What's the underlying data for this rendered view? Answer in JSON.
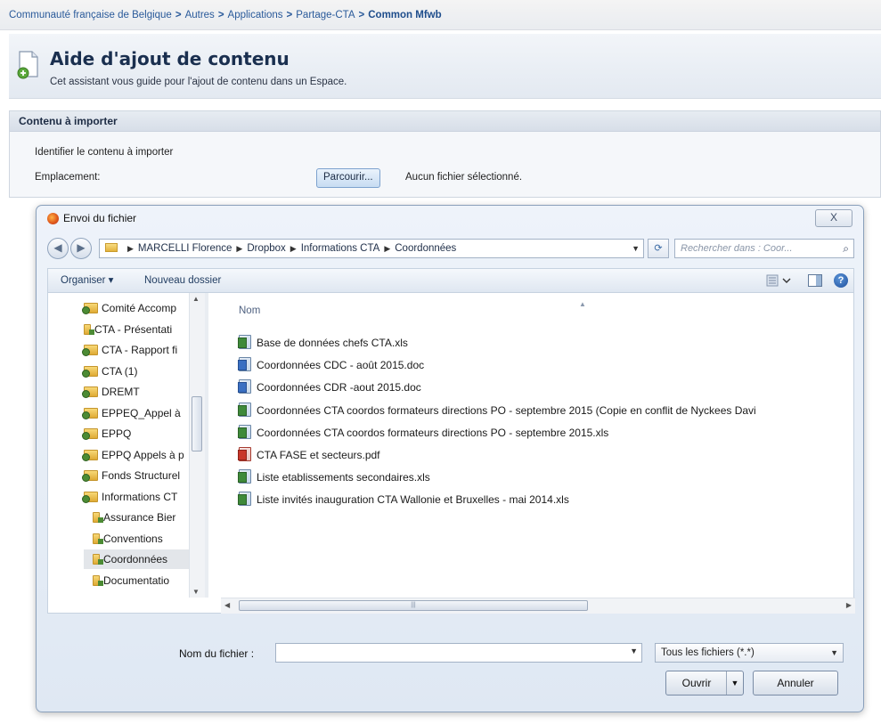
{
  "breadcrumb": {
    "items": [
      "Communauté française de Belgique",
      "Autres",
      "Applications",
      "Partage-CTA"
    ],
    "current": "Common Mfwb",
    "separator": ">"
  },
  "banner": {
    "title": "Aide d'ajout de contenu",
    "subtitle": "Cet assistant vous guide pour l'ajout de contenu dans un Espace."
  },
  "import": {
    "section_title": "Contenu à importer",
    "identify_label": "Identifier le contenu à importer",
    "location_label": "Emplacement:",
    "browse_label": "Parcourir...",
    "no_file_text": "Aucun fichier sélectionné."
  },
  "dialog": {
    "title": "Envoi du fichier",
    "close_label": "X",
    "address": {
      "segments": [
        "MARCELLI Florence",
        "Dropbox",
        "Informations CTA",
        "Coordonnées"
      ]
    },
    "search_placeholder": "Rechercher dans : Coor...",
    "toolbar": {
      "organize": "Organiser ▾",
      "new_folder": "Nouveau dossier"
    },
    "tree": [
      {
        "label": "Comité Accomp",
        "type": "shared",
        "indent": 0
      },
      {
        "label": "CTA - Présentati",
        "type": "sub",
        "indent": 0
      },
      {
        "label": "CTA - Rapport fi",
        "type": "shared",
        "indent": 0
      },
      {
        "label": "CTA (1)",
        "type": "shared",
        "indent": 0
      },
      {
        "label": "DREMT",
        "type": "shared",
        "indent": 0
      },
      {
        "label": "EPPEQ_Appel à",
        "type": "shared",
        "indent": 0
      },
      {
        "label": "EPPQ",
        "type": "shared",
        "indent": 0
      },
      {
        "label": "EPPQ Appels à p",
        "type": "shared",
        "indent": 0
      },
      {
        "label": "Fonds Structurel",
        "type": "shared",
        "indent": 0
      },
      {
        "label": "Informations CT",
        "type": "shared",
        "indent": 0
      },
      {
        "label": "Assurance Bier",
        "type": "sub",
        "indent": 1
      },
      {
        "label": "Conventions",
        "type": "sub",
        "indent": 1
      },
      {
        "label": "Coordonnées",
        "type": "sub",
        "indent": 1,
        "selected": true
      },
      {
        "label": "Documentatio",
        "type": "sub",
        "indent": 1
      }
    ],
    "column_header": "Nom",
    "files": [
      {
        "name": "Base de données chefs CTA.xls",
        "kind": "xls"
      },
      {
        "name": "Coordonnées CDC - août 2015.doc",
        "kind": "doc"
      },
      {
        "name": "Coordonnées CDR -aout 2015.doc",
        "kind": "doc"
      },
      {
        "name": "Coordonnées CTA coordos formateurs directions PO - septembre 2015 (Copie en conflit de Nyckees Davi",
        "kind": "xls"
      },
      {
        "name": "Coordonnées CTA coordos formateurs directions PO - septembre 2015.xls",
        "kind": "xls"
      },
      {
        "name": "CTA FASE et secteurs.pdf",
        "kind": "pdf"
      },
      {
        "name": "Liste etablissements secondaires.xls",
        "kind": "xls"
      },
      {
        "name": "Liste invités inauguration CTA Wallonie et Bruxelles - mai 2014.xls",
        "kind": "xls"
      }
    ],
    "filename_label": "Nom du fichier :",
    "filename_value": "",
    "filter_label": "Tous les fichiers (*.*)",
    "open_label": "Ouvrir",
    "cancel_label": "Annuler"
  }
}
